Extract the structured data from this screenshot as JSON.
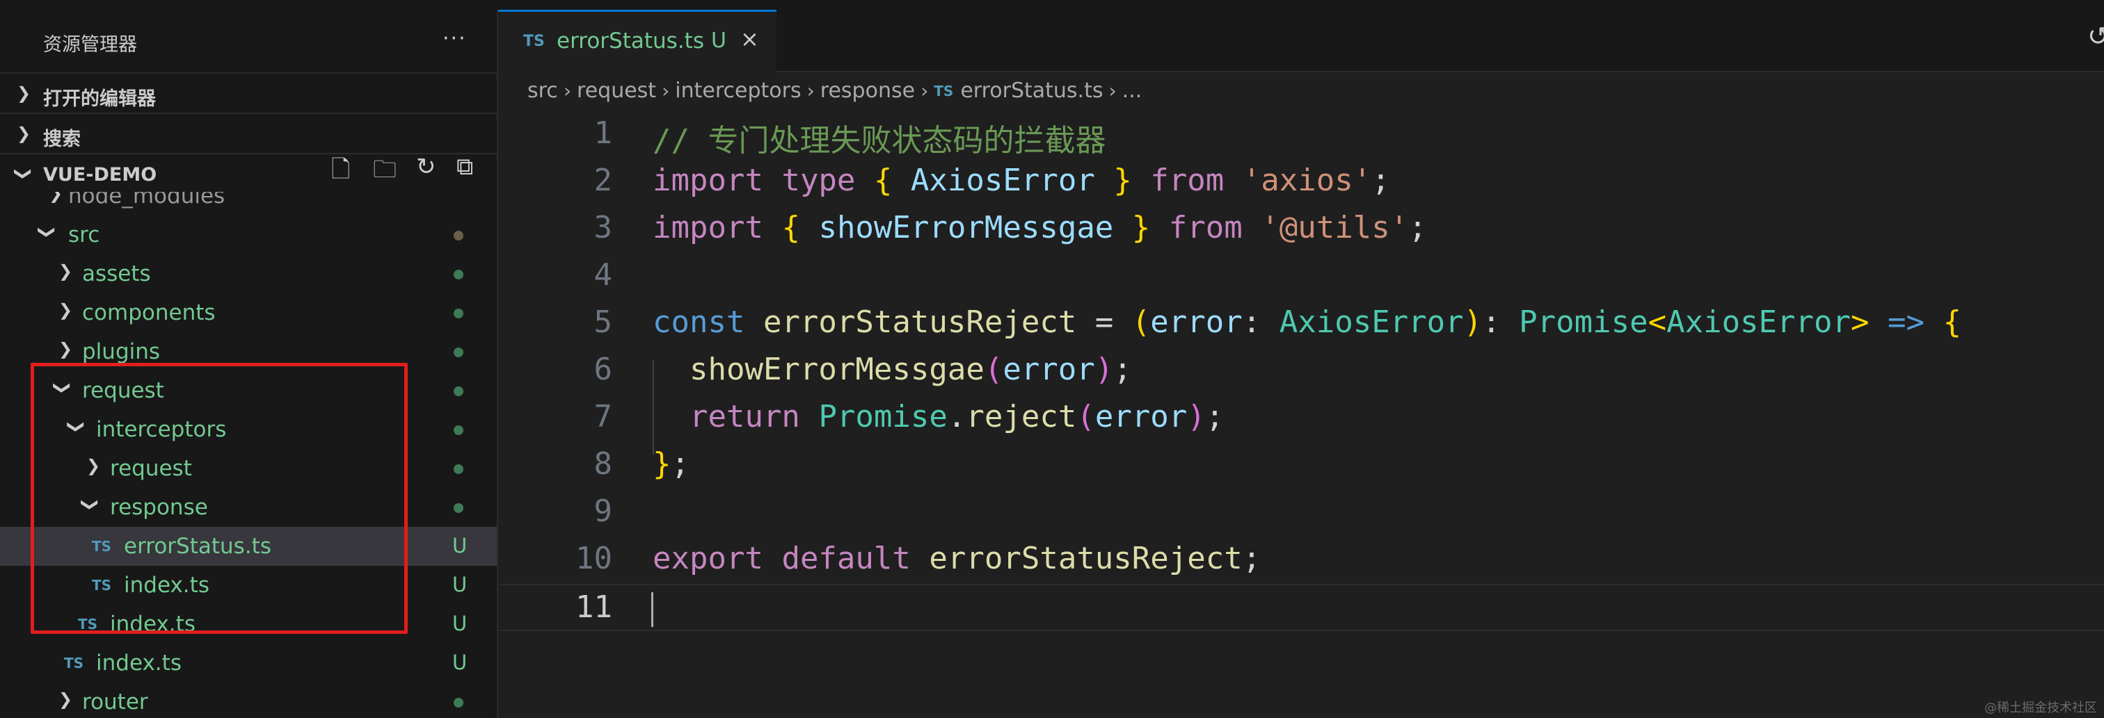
{
  "sidebar": {
    "title": "资源管理器",
    "more": "···",
    "sections": {
      "open_editors": "打开的编辑器",
      "search": "搜索",
      "project": "VUE-DEMO"
    },
    "tree": [
      {
        "name": "node_modules",
        "status": ""
      },
      {
        "name": "src",
        "status": ""
      },
      {
        "name": "assets",
        "status": ""
      },
      {
        "name": "components",
        "status": ""
      },
      {
        "name": "plugins",
        "status": ""
      },
      {
        "name": "request",
        "status": ""
      },
      {
        "name": "interceptors",
        "status": ""
      },
      {
        "name": "request",
        "status": ""
      },
      {
        "name": "response",
        "status": ""
      },
      {
        "name": "errorStatus.ts",
        "status": "U",
        "icon": "TS"
      },
      {
        "name": "index.ts",
        "status": "U",
        "icon": "TS"
      },
      {
        "name": "index.ts",
        "status": "U",
        "icon": "TS"
      },
      {
        "name": "index.ts",
        "status": "U",
        "icon": "TS"
      },
      {
        "name": "router",
        "status": ""
      }
    ]
  },
  "tab": {
    "icon": "TS",
    "name": "errorStatus.ts",
    "status": "U",
    "close": "×"
  },
  "breadcrumbs": {
    "items": [
      "src",
      "request",
      "interceptors",
      "response",
      "errorStatus.ts",
      "..."
    ],
    "file_icon": "TS"
  },
  "editor": {
    "line_numbers": [
      "1",
      "2",
      "3",
      "4",
      "5",
      "6",
      "7",
      "8",
      "9",
      "10",
      "11"
    ],
    "lines": [
      "// 专门处理失败状态码的拦截器",
      "import type { AxiosError } from 'axios';",
      "import { showErrorMessgae } from '@utils';",
      "",
      "const errorStatusReject = (error: AxiosError): Promise<AxiosError> => {",
      "  showErrorMessgae(error);",
      "  return Promise.reject(error);",
      "};",
      "",
      "export default errorStatusReject;",
      ""
    ],
    "current_line": 11
  },
  "watermark": "@稀土掘金技术社区",
  "colors": {
    "accent": "#0078d4",
    "untracked": "#73c991",
    "highlight_box": "#e01e1e"
  }
}
